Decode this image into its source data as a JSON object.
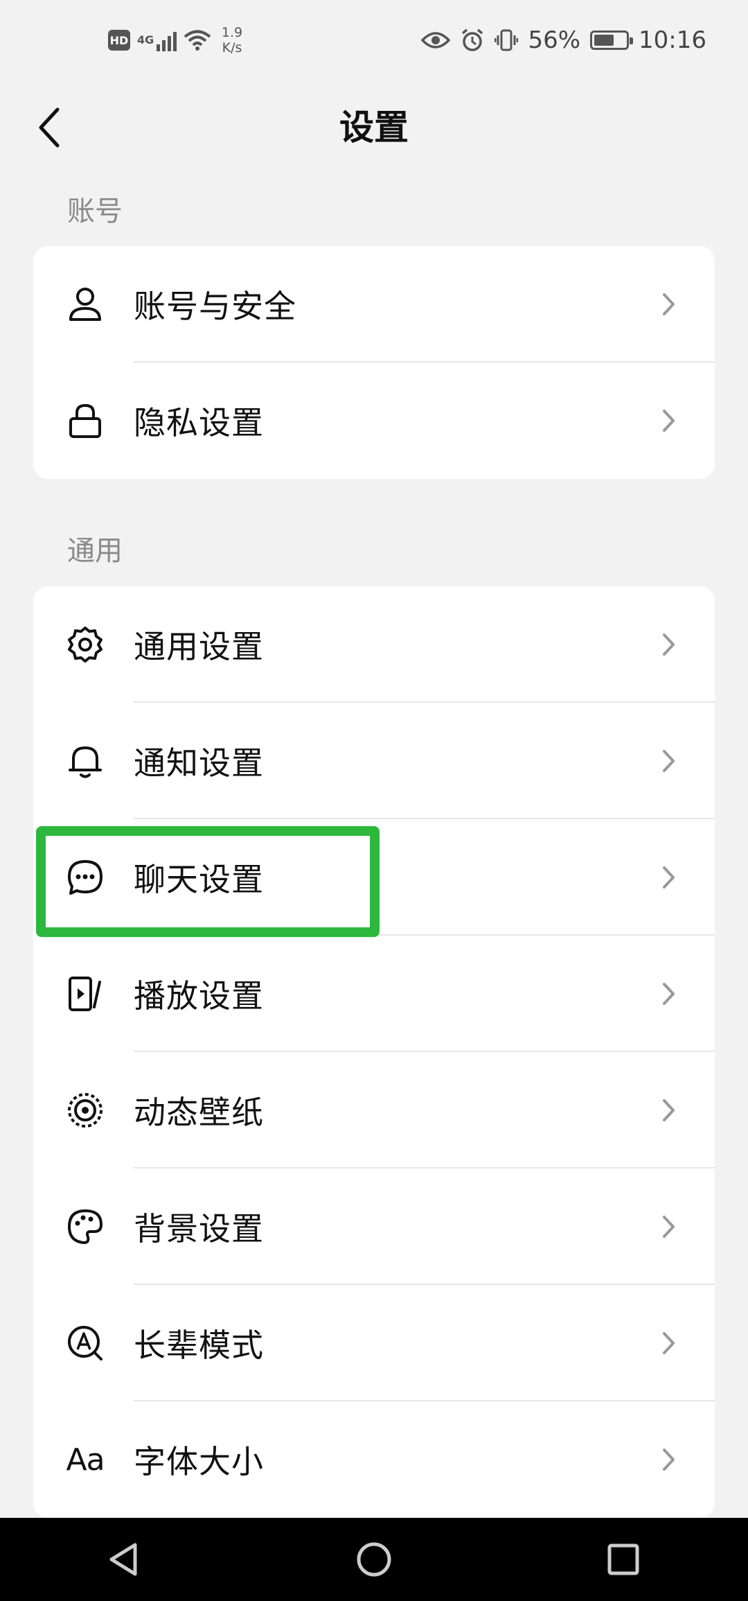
{
  "status_bar": {
    "hd": "HD",
    "network": "4G",
    "speed_value": "1.9",
    "speed_unit": "K/s",
    "battery": "56%",
    "time": "10:16"
  },
  "header": {
    "title": "设置"
  },
  "sections": [
    {
      "label": "账号",
      "items": [
        {
          "label": "账号与安全",
          "icon": "person-icon"
        },
        {
          "label": "隐私设置",
          "icon": "lock-icon"
        }
      ]
    },
    {
      "label": "通用",
      "items": [
        {
          "label": "通用设置",
          "icon": "gear-icon"
        },
        {
          "label": "通知设置",
          "icon": "bell-icon"
        },
        {
          "label": "聊天设置",
          "icon": "chat-bubble-icon"
        },
        {
          "label": "播放设置",
          "icon": "play-device-icon"
        },
        {
          "label": "动态壁纸",
          "icon": "target-icon"
        },
        {
          "label": "背景设置",
          "icon": "palette-icon"
        },
        {
          "label": "长辈模式",
          "icon": "elder-mode-icon"
        },
        {
          "label": "字体大小",
          "icon": "font-size-icon",
          "icon_text": "Aa"
        }
      ]
    }
  ],
  "highlight_color": "#2db83d"
}
